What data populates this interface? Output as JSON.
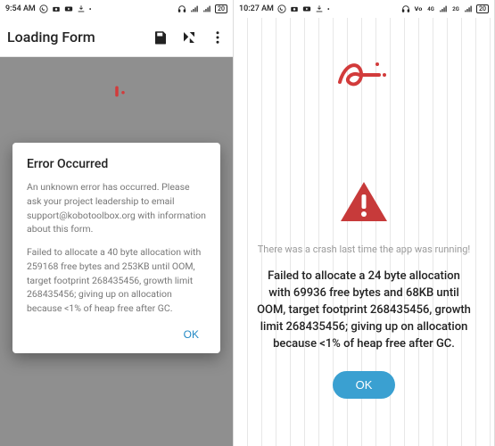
{
  "left": {
    "statusbar": {
      "time": "9:54 AM",
      "battery": "20"
    },
    "appbar": {
      "title": "Loading Form"
    },
    "dialog": {
      "title": "Error Occurred",
      "para1": "An unknown error has occurred. Please ask your project leadership to email support@kobotoolbox.org with information about this form.",
      "para2": "Failed to allocate a 40 byte allocation with 259168 free bytes and 253KB until OOM, target footprint 268435456, growth limit 268435456; giving up on allocation because <1% of heap free after GC.",
      "ok": "OK"
    }
  },
  "right": {
    "statusbar": {
      "time": "10:27 AM",
      "battery": "20"
    },
    "crash": {
      "subtitle": "There was a crash last time the app was running!",
      "message": "Failed to allocate a 24 byte allocation with 69936 free bytes and 68KB until OOM, target footprint 268435456, growth limit 268435456; giving up on allocation because <1% of heap free after GC.",
      "ok": "OK"
    }
  }
}
